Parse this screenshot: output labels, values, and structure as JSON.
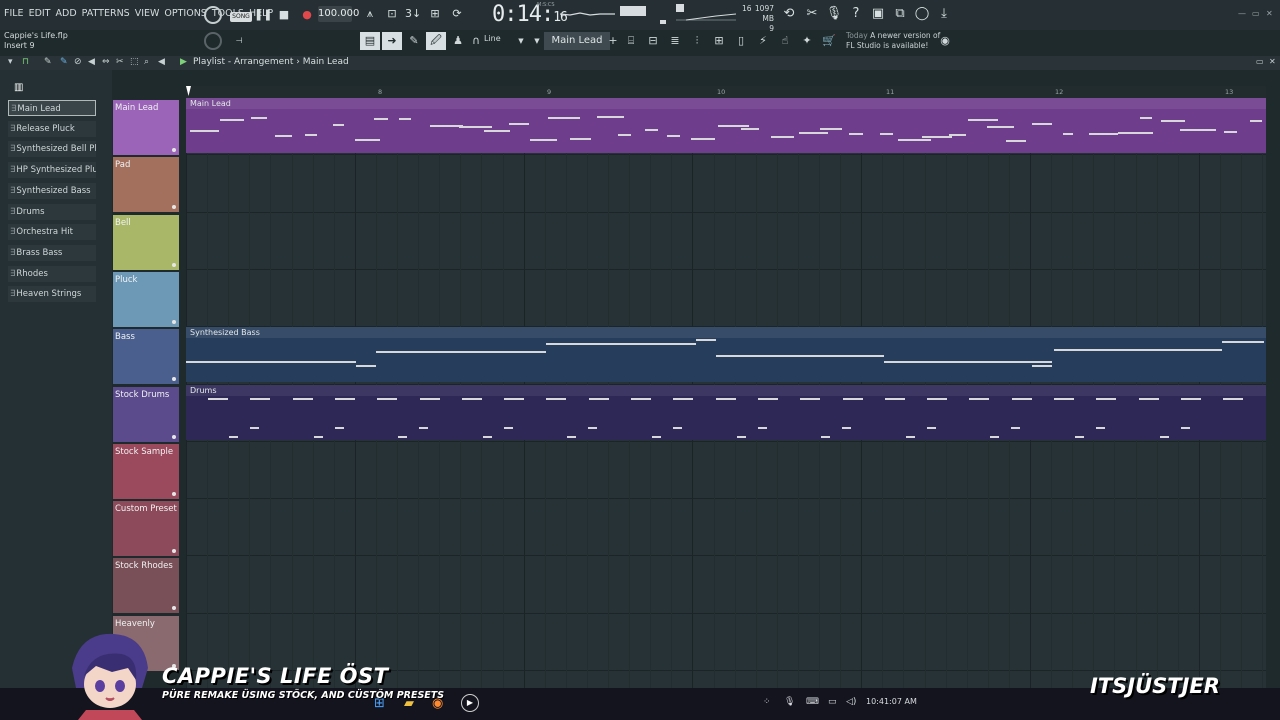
{
  "menu": [
    "FILE",
    "EDIT",
    "ADD",
    "PATTERNS",
    "VIEW",
    "OPTIONS",
    "TOOLS",
    "HELP"
  ],
  "file": {
    "name": "Cappie's Life.flp",
    "insert": "Insert 9"
  },
  "transport": {
    "mode": "SONG",
    "tempo": "100.000",
    "time_main": "0:14:",
    "time_sub": "16",
    "time_unit": "M:S:CS"
  },
  "cpu": {
    "voices": "16",
    "memory": "1097 MB",
    "polyphony": "9"
  },
  "toolbar": {
    "snap": "Line",
    "pattern": "Main Lead"
  },
  "news": {
    "when": "Today",
    "text1": "A newer version of",
    "text2": "FL Studio is available!"
  },
  "playlist": {
    "title": "Playlist - Arrangement",
    "pattern": "Main Lead"
  },
  "ruler": [
    "8",
    "9",
    "10",
    "11",
    "12",
    "13"
  ],
  "sidebar": [
    {
      "label": "Main Lead",
      "selected": true
    },
    {
      "label": "Release Pluck"
    },
    {
      "label": "Synthesized Bell Pluck"
    },
    {
      "label": "HP Synthesized Pluck"
    },
    {
      "label": "Synthesized Bass"
    },
    {
      "label": "Drums"
    },
    {
      "label": "Orchestra Hit"
    },
    {
      "label": "Brass Bass"
    },
    {
      "label": "Rhodes"
    },
    {
      "label": "Heaven Strings"
    }
  ],
  "tracks": [
    {
      "label": "Main Lead",
      "color": "#9b64b8"
    },
    {
      "label": "Pad",
      "color": "#a4705e"
    },
    {
      "label": "Bell",
      "color": "#a9b868"
    },
    {
      "label": "Pluck",
      "color": "#6d99b6"
    },
    {
      "label": "Bass",
      "color": "#4a5f8e"
    },
    {
      "label": "Stock Drums",
      "color": "#5b4a8c"
    },
    {
      "label": "Stock Sample",
      "color": "#9a4a5c"
    },
    {
      "label": "Custom Preset",
      "color": "#8c4a5a"
    },
    {
      "label": "Stock Rhodes",
      "color": "#7a5058"
    },
    {
      "label": "Heavenly",
      "color": "#8a6a6e"
    }
  ],
  "clips": [
    {
      "label": "Main Lead",
      "track": 0,
      "color": "#6e3d8c"
    },
    {
      "label": "Synthesized Bass",
      "track": 4,
      "color": "#263d5c"
    },
    {
      "label": "Drums",
      "track": 5,
      "color": "#2d2856"
    }
  ],
  "taskbar": {
    "clock": "10:41:07 AM"
  },
  "overlay": {
    "title": "CAPPIE'S LIFE ÖST",
    "subtitle": "PÜRE REMAKE ÜSING STÖCK, AND CÜSTÖM PRESETS",
    "channel": "ITSJÜSTJER"
  }
}
